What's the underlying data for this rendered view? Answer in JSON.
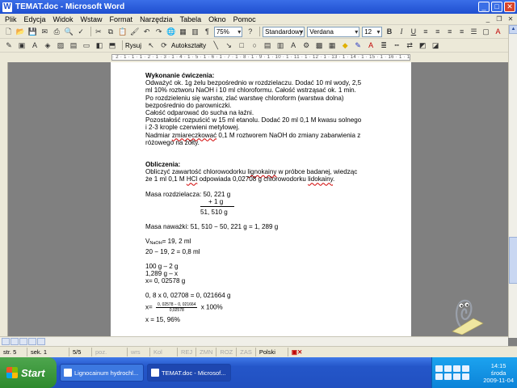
{
  "window": {
    "title": "TEMAT.doc - Microsoft Word"
  },
  "menu": [
    "Plik",
    "Edycja",
    "Widok",
    "Wstaw",
    "Format",
    "Narzędzia",
    "Tabela",
    "Okno",
    "Pomoc"
  ],
  "toolbar": {
    "zoom": "75%",
    "style": "Standardowy",
    "font": "Verdana",
    "size": "12",
    "bold": "B",
    "italic": "I",
    "underline": "U",
    "draw_label": "Rysuj",
    "autoshapes_label": "Autokształty"
  },
  "ruler": {
    "scale": "· 2 · 1 · 1 · 1 · 2 · 1 · 3 · 1 · 4 · 1 · 5 · 1 · 6 · 1 · 7 · 1 · 8 · 1 · 9 · 1 · 10 · 1 · 11 · 1 · 12 · 1 · 13 · 1 · 14 · 1 · 15 · 1 · 16 · 1 · 17 · 1 · 18 ·"
  },
  "document": {
    "section1_heading": "Wykonanie ćwiczenia:",
    "section1_lines": [
      "Odważyć ok. 1g żelu bezpośrednio w rozdzielaczu. Dodać 10 ml wody, 2,5",
      "ml 10% roztworu NaOH i 10 ml chloroformu. Całość wstrząsać ok. 1 min.",
      "Po rozdzieleniu się warstw, zlać warstwę chloroform (warstwa dolna)",
      "bezpośrednio do parowniczki.",
      "Całość odparować do sucha na łaźni.",
      "Pozostałość rozpuścić w 15 ml etanolu. Dodać 20 ml 0,1 M kwasu solnego",
      "i 2-3 krople czerwieni metylowej."
    ],
    "titration_pre": "Nadmiar ",
    "titration_word": "zmiareczkować",
    "titration_post": " 0,1 M roztworem NaOH do zmiany zabarwienia z",
    "titration_cont": "różowego na żółty.",
    "section2_heading": "Obliczenia:",
    "calc_intro_pre": "Obliczyć zawartość chlorowodorku ",
    "calc_intro_word": "lignokainy",
    "calc_intro_post": " w próbce badanej, wiedząc",
    "calc_intro2_pre": "że 1 ml 0,1 M ",
    "calc_intro2_word1": "HCl",
    "calc_intro2_mid": " odpowiada 0,02708 g chlorowodorku ",
    "calc_intro2_word2": "lidokainy",
    "calc_intro2_post": ".",
    "mass_funnel": "Masa rozdzielacza: 50, 221 g",
    "plus": "+ 1 g",
    "sum": "51, 510 g",
    "mass_sample": "Masa naważki: 51, 510 − 50, 221 g = 1, 289 g",
    "v_label": "V",
    "v_sub": "NaOH",
    "v_value": "= 19, 2 ml",
    "v_calc": "20 − 19, 2 = 0,8 ml",
    "prop1": "100 g – 2 g",
    "prop2": "1,289 g – x",
    "prop3": "x= 0, 02578 g",
    "mult": "0, 8 x 0, 02708 = 0, 021664 g",
    "frac_prefix": "x=",
    "frac_num": "0, 02578 − 0, 021664",
    "frac_den": "0,02578",
    "frac_suffix": "x 100%",
    "result": "x = 15, 96%"
  },
  "status": {
    "page": "str. 5",
    "section": "sek. 1",
    "pages": "5/5",
    "pos": "poz.",
    "line": "wrs",
    "col": "Kol",
    "rec": "REJ",
    "trk": "ZMN",
    "ext": "ROZ",
    "ovr": "ZAS",
    "lang": "Polski"
  },
  "taskbar": {
    "start": "Start",
    "tasks": [
      "Lignocainum hydrochl...",
      "TEMAT.doc - Microsof..."
    ]
  },
  "clock": {
    "time": "14:15",
    "day": "środa",
    "date": "2009-11-04"
  }
}
